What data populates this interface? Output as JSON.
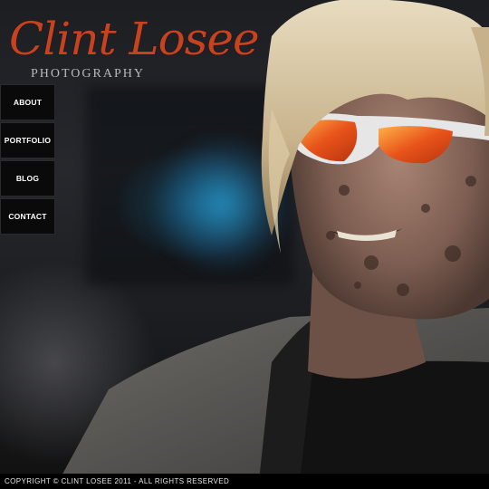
{
  "logo": {
    "name": "Clint Losee",
    "tagline": "PHOTOGRAPHY"
  },
  "nav": {
    "items": [
      {
        "label": "ABOUT"
      },
      {
        "label": "PORTFOLIO"
      },
      {
        "label": "BLOG"
      },
      {
        "label": "CONTACT"
      }
    ]
  },
  "footer": {
    "copyright": "COPYRIGHT © CLINT LOSEE 2011 - ALL RIGHTS RESERVED"
  },
  "colors": {
    "logo_accent": "#c9421f",
    "nav_bg": "#0a0a0a",
    "footer_bg": "#000000",
    "lens_orange": "#e8541a"
  },
  "hero": {
    "image_subject": "mud-covered man with blond hair and orange sunglasses"
  }
}
